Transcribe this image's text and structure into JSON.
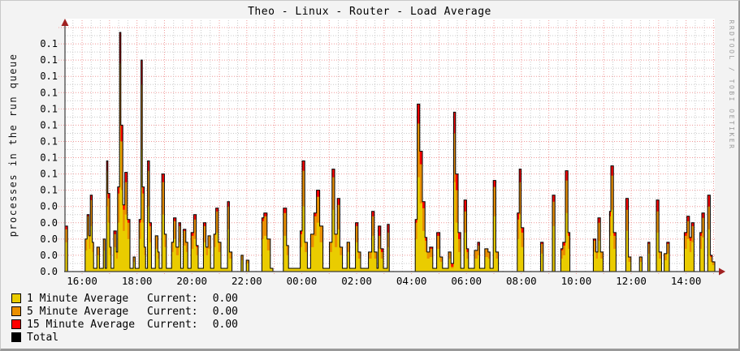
{
  "header": {
    "title": "Theo - Linux - Router - Load Average",
    "ylabel": "processes in the run queue",
    "watermark": "RRDTOOL / TOBI OETIKER"
  },
  "legend": {
    "items": [
      {
        "swatch": "yellow-square",
        "color": "#EACC00",
        "label": "1 Minute Average",
        "current_label": "Current:",
        "value": "0.00"
      },
      {
        "swatch": "orange-square",
        "color": "#EA8F00",
        "label": "5 Minute Average",
        "current_label": "Current:",
        "value": "0.00"
      },
      {
        "swatch": "red-square",
        "color": "#FF0000",
        "label": "15 Minute Average",
        "current_label": "Current:",
        "value": "0.00"
      },
      {
        "swatch": "black-square",
        "color": "#000000",
        "label": "Total"
      }
    ]
  },
  "chart_data": {
    "type": "area",
    "title": "Theo - Linux - Router - Load Average",
    "ylabel": "processes in the run queue",
    "xlabel": "",
    "ylim": [
      0,
      0.1515
    ],
    "grid": true,
    "legend_position": "bottom-left",
    "colors": {
      "minute1": "#EACC00",
      "minute5": "#EA8F00",
      "minute15": "#FF0000",
      "total_line": "#000000",
      "grid_major": "#f09898",
      "grid_minor": "#c9c9c9",
      "axis": "#3a3a3a",
      "arrow": "#a02020",
      "plot_bg": "#ffffff",
      "canvas_bg": "#f3f3f3"
    },
    "y_axis": {
      "tick_step": 0.01,
      "minor_step": 0.005,
      "labels": [
        "0.0",
        "0.0",
        "0.0",
        "0.0",
        "0.0",
        "0.1",
        "0.1",
        "0.1",
        "0.1",
        "0.1",
        "0.1",
        "0.1",
        "0.1",
        "0.1",
        "0.1"
      ]
    },
    "x_axis": {
      "labels": [
        "16:00",
        "18:00",
        "20:00",
        "22:00",
        "00:00",
        "02:00",
        "04:00",
        "06:00",
        "08:00",
        "10:00",
        "12:00",
        "14:00"
      ],
      "first_label_frac": 0.0263,
      "label_step_frac": 0.0845,
      "minor_lines_per_hour": 3
    },
    "series_names": [
      "1 Minute Average",
      "5 Minute Average",
      "15 Minute Average",
      "Total"
    ],
    "samples_format": [
      "time_fraction",
      "avg_1min",
      "avg_5min",
      "avg_15min"
    ],
    "samples": [
      [
        0.0,
        0.018,
        0.008,
        0.002
      ],
      [
        0.004,
        0,
        0,
        0
      ],
      [
        0.031,
        0.013,
        0.007,
        0
      ],
      [
        0.034,
        0.022,
        0.012,
        0.001
      ],
      [
        0.037,
        0.014,
        0.008,
        0
      ],
      [
        0.039,
        0.028,
        0.016,
        0.003
      ],
      [
        0.042,
        0.012,
        0.006,
        0
      ],
      [
        0.044,
        0.002,
        0,
        0
      ],
      [
        0.049,
        0.01,
        0.005,
        0
      ],
      [
        0.053,
        0.002,
        0,
        0
      ],
      [
        0.059,
        0.013,
        0.007,
        0
      ],
      [
        0.062,
        0.002,
        0,
        0
      ],
      [
        0.064,
        0.04,
        0.022,
        0.006
      ],
      [
        0.066,
        0.03,
        0.015,
        0.003
      ],
      [
        0.069,
        0.01,
        0.005,
        0
      ],
      [
        0.071,
        0.002,
        0,
        0
      ],
      [
        0.075,
        0.015,
        0.008,
        0.002
      ],
      [
        0.079,
        0.008,
        0.004,
        0
      ],
      [
        0.081,
        0.03,
        0.018,
        0.004
      ],
      [
        0.084,
        0.08,
        0.048,
        0.019
      ],
      [
        0.086,
        0.05,
        0.03,
        0.01
      ],
      [
        0.089,
        0.025,
        0.013,
        0.003
      ],
      [
        0.092,
        0.035,
        0.02,
        0.006
      ],
      [
        0.096,
        0.02,
        0.01,
        0.002
      ],
      [
        0.1,
        0.002,
        0,
        0
      ],
      [
        0.105,
        0.006,
        0.003,
        0
      ],
      [
        0.108,
        0.002,
        0,
        0
      ],
      [
        0.114,
        0.02,
        0.01,
        0.002
      ],
      [
        0.117,
        0.075,
        0.04,
        0.015
      ],
      [
        0.119,
        0.03,
        0.018,
        0.004
      ],
      [
        0.122,
        0.01,
        0.005,
        0
      ],
      [
        0.124,
        0.002,
        0,
        0
      ],
      [
        0.127,
        0.04,
        0.022,
        0.006
      ],
      [
        0.13,
        0.018,
        0.01,
        0.002
      ],
      [
        0.133,
        0.002,
        0,
        0
      ],
      [
        0.139,
        0.014,
        0.008,
        0
      ],
      [
        0.143,
        0.008,
        0.004,
        0
      ],
      [
        0.145,
        0.002,
        0,
        0
      ],
      [
        0.149,
        0.035,
        0.02,
        0.005
      ],
      [
        0.153,
        0.015,
        0.008,
        0
      ],
      [
        0.156,
        0.002,
        0,
        0
      ],
      [
        0.164,
        0.012,
        0.006,
        0
      ],
      [
        0.167,
        0.02,
        0.011,
        0.002
      ],
      [
        0.171,
        0.01,
        0.005,
        0
      ],
      [
        0.175,
        0.018,
        0.01,
        0.002
      ],
      [
        0.178,
        0.002,
        0,
        0
      ],
      [
        0.182,
        0.016,
        0.009,
        0.001
      ],
      [
        0.186,
        0.012,
        0.006,
        0
      ],
      [
        0.189,
        0.002,
        0,
        0
      ],
      [
        0.194,
        0.014,
        0.008,
        0.002
      ],
      [
        0.198,
        0.02,
        0.012,
        0.003
      ],
      [
        0.202,
        0.01,
        0.005,
        0.001
      ],
      [
        0.205,
        0.002,
        0,
        0
      ],
      [
        0.213,
        0.018,
        0.01,
        0.002
      ],
      [
        0.217,
        0.01,
        0.005,
        0
      ],
      [
        0.22,
        0.014,
        0.008,
        0
      ],
      [
        0.224,
        0.002,
        0,
        0
      ],
      [
        0.229,
        0.015,
        0.008,
        0
      ],
      [
        0.232,
        0.024,
        0.013,
        0.002
      ],
      [
        0.236,
        0.012,
        0.006,
        0
      ],
      [
        0.24,
        0.002,
        0,
        0
      ],
      [
        0.25,
        0.026,
        0.014,
        0.003
      ],
      [
        0.253,
        0.008,
        0.004,
        0
      ],
      [
        0.257,
        0,
        0,
        0
      ],
      [
        0.271,
        0.007,
        0.003,
        0
      ],
      [
        0.274,
        0,
        0,
        0
      ],
      [
        0.279,
        0.005,
        0.002,
        0
      ],
      [
        0.283,
        0,
        0,
        0
      ],
      [
        0.303,
        0.02,
        0.011,
        0.002
      ],
      [
        0.306,
        0.022,
        0.012,
        0.002
      ],
      [
        0.311,
        0.013,
        0.007,
        0
      ],
      [
        0.316,
        0.002,
        0,
        0
      ],
      [
        0.32,
        0,
        0,
        0
      ],
      [
        0.336,
        0.022,
        0.014,
        0.003
      ],
      [
        0.341,
        0.01,
        0.006,
        0
      ],
      [
        0.344,
        0.002,
        0,
        0
      ],
      [
        0.362,
        0.015,
        0.008,
        0.002
      ],
      [
        0.365,
        0.04,
        0.022,
        0.006
      ],
      [
        0.369,
        0.012,
        0.006,
        0
      ],
      [
        0.373,
        0.002,
        0,
        0
      ],
      [
        0.378,
        0.015,
        0.008,
        0
      ],
      [
        0.383,
        0.022,
        0.012,
        0.002
      ],
      [
        0.387,
        0.03,
        0.016,
        0.004
      ],
      [
        0.392,
        0.018,
        0.01,
        0
      ],
      [
        0.397,
        0.002,
        0,
        0
      ],
      [
        0.407,
        0.012,
        0.006,
        0
      ],
      [
        0.411,
        0.038,
        0.02,
        0.005
      ],
      [
        0.415,
        0.015,
        0.008,
        0
      ],
      [
        0.419,
        0.026,
        0.015,
        0.004
      ],
      [
        0.423,
        0.01,
        0.005,
        0
      ],
      [
        0.427,
        0.002,
        0,
        0
      ],
      [
        0.434,
        0.012,
        0.006,
        0
      ],
      [
        0.438,
        0.002,
        0,
        0
      ],
      [
        0.447,
        0.018,
        0.01,
        0.002
      ],
      [
        0.451,
        0.008,
        0.004,
        0
      ],
      [
        0.455,
        0.002,
        0,
        0
      ],
      [
        0.467,
        0.008,
        0.004,
        0
      ],
      [
        0.472,
        0.022,
        0.012,
        0.003
      ],
      [
        0.476,
        0.008,
        0.004,
        0
      ],
      [
        0.48,
        0.002,
        0,
        0
      ],
      [
        0.482,
        0.014,
        0.008,
        0.006
      ],
      [
        0.486,
        0.008,
        0.004,
        0.002
      ],
      [
        0.49,
        0.002,
        0,
        0
      ],
      [
        0.496,
        0.015,
        0.009,
        0.005
      ],
      [
        0.499,
        0,
        0,
        0
      ],
      [
        0.539,
        0.02,
        0.01,
        0.002
      ],
      [
        0.542,
        0.058,
        0.033,
        0.012
      ],
      [
        0.546,
        0.042,
        0.024,
        0.008
      ],
      [
        0.55,
        0.025,
        0.014,
        0.004
      ],
      [
        0.554,
        0.012,
        0.007,
        0.002
      ],
      [
        0.557,
        0.008,
        0.004,
        0
      ],
      [
        0.561,
        0.009,
        0.005,
        0.001
      ],
      [
        0.566,
        0.002,
        0,
        0
      ],
      [
        0.572,
        0.014,
        0.008,
        0.002
      ],
      [
        0.577,
        0.006,
        0.003,
        0
      ],
      [
        0.581,
        0.002,
        0,
        0
      ],
      [
        0.59,
        0.008,
        0.004,
        0
      ],
      [
        0.594,
        0.002,
        0.001,
        0.002
      ],
      [
        0.598,
        0.055,
        0.03,
        0.013
      ],
      [
        0.601,
        0.03,
        0.02,
        0.01
      ],
      [
        0.605,
        0.012,
        0.008,
        0.004
      ],
      [
        0.609,
        0.002,
        0,
        0
      ],
      [
        0.614,
        0.024,
        0.013,
        0.007
      ],
      [
        0.618,
        0.008,
        0.004,
        0.002
      ],
      [
        0.621,
        0.002,
        0,
        0
      ],
      [
        0.63,
        0.008,
        0.005,
        0
      ],
      [
        0.635,
        0.01,
        0.006,
        0.002
      ],
      [
        0.638,
        0.002,
        0,
        0
      ],
      [
        0.646,
        0.009,
        0.005,
        0
      ],
      [
        0.651,
        0.008,
        0.004,
        0
      ],
      [
        0.654,
        0.002,
        0,
        0
      ],
      [
        0.659,
        0.034,
        0.018,
        0.004
      ],
      [
        0.663,
        0.008,
        0.004,
        0
      ],
      [
        0.667,
        0,
        0,
        0
      ],
      [
        0.696,
        0.02,
        0.012,
        0.004
      ],
      [
        0.699,
        0.035,
        0.02,
        0.008
      ],
      [
        0.702,
        0.015,
        0.009,
        0.003
      ],
      [
        0.706,
        0,
        0,
        0
      ],
      [
        0.732,
        0.011,
        0.006,
        0.001
      ],
      [
        0.736,
        0,
        0,
        0
      ],
      [
        0.75,
        0.028,
        0.015,
        0.004
      ],
      [
        0.754,
        0,
        0,
        0
      ],
      [
        0.763,
        0.008,
        0.005,
        0.001
      ],
      [
        0.766,
        0.01,
        0.006,
        0.002
      ],
      [
        0.77,
        0.036,
        0.02,
        0.006
      ],
      [
        0.774,
        0.014,
        0.008,
        0.002
      ],
      [
        0.777,
        0,
        0,
        0
      ],
      [
        0.813,
        0.012,
        0.007,
        0.001
      ],
      [
        0.817,
        0.008,
        0.004,
        0
      ],
      [
        0.82,
        0.019,
        0.011,
        0.003
      ],
      [
        0.824,
        0.008,
        0.004,
        0
      ],
      [
        0.828,
        0,
        0,
        0
      ],
      [
        0.838,
        0.022,
        0.012,
        0.003
      ],
      [
        0.84,
        0.038,
        0.021,
        0.006
      ],
      [
        0.844,
        0.014,
        0.008,
        0.002
      ],
      [
        0.848,
        0,
        0,
        0
      ],
      [
        0.863,
        0.025,
        0.013,
        0.007
      ],
      [
        0.867,
        0.006,
        0.003,
        0
      ],
      [
        0.871,
        0,
        0,
        0
      ],
      [
        0.884,
        0.006,
        0.003,
        0
      ],
      [
        0.888,
        0,
        0,
        0
      ],
      [
        0.897,
        0.011,
        0.006,
        0.001
      ],
      [
        0.9,
        0,
        0,
        0
      ],
      [
        0.91,
        0.024,
        0.013,
        0.007
      ],
      [
        0.914,
        0.008,
        0.004,
        0
      ],
      [
        0.918,
        0,
        0,
        0
      ],
      [
        0.922,
        0.007,
        0.004,
        0
      ],
      [
        0.926,
        0.011,
        0.006,
        0.001
      ],
      [
        0.93,
        0,
        0,
        0
      ],
      [
        0.953,
        0.014,
        0.008,
        0.002
      ],
      [
        0.957,
        0.02,
        0.011,
        0.003
      ],
      [
        0.961,
        0.012,
        0.007,
        0.002
      ],
      [
        0.964,
        0.018,
        0.01,
        0.002
      ],
      [
        0.968,
        0,
        0,
        0
      ],
      [
        0.977,
        0.014,
        0.008,
        0.002
      ],
      [
        0.98,
        0.021,
        0.012,
        0.003
      ],
      [
        0.984,
        0,
        0,
        0
      ],
      [
        0.989,
        0.026,
        0.014,
        0.007
      ],
      [
        0.993,
        0.006,
        0.003,
        0.001
      ],
      [
        0.996,
        0.004,
        0.002,
        0
      ],
      [
        1.0,
        0,
        0,
        0
      ]
    ]
  }
}
